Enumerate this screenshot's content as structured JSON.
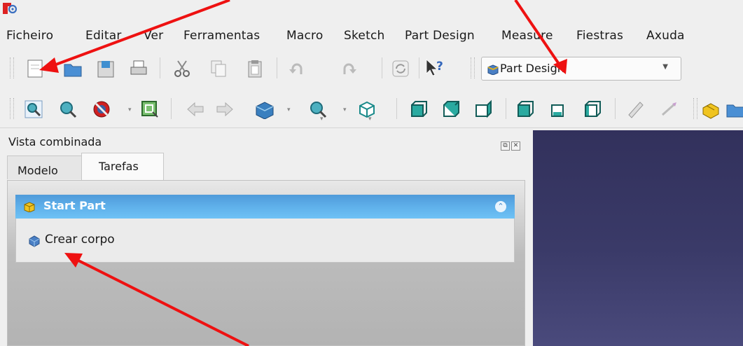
{
  "menubar": {
    "items": [
      "Ficheiro",
      "Editar",
      "Ver",
      "Ferramentas",
      "Macro",
      "Sketch",
      "Part Design",
      "Measure",
      "Fiestras",
      "Axuda"
    ]
  },
  "toolbar": {
    "workbench_select": {
      "value": "Part Design"
    }
  },
  "combo_view": {
    "title": "Vista combinada",
    "tabs": [
      {
        "label": "Modelo",
        "active": false
      },
      {
        "label": "Tarefas",
        "active": true
      }
    ]
  },
  "task_panel": {
    "title": "Start Part",
    "actions": [
      "Crear corpo"
    ]
  },
  "colors": {
    "annotation_arrow": "#ee1111",
    "task_header": "#5aaae6",
    "viewport_bg": "#3a3a68"
  }
}
